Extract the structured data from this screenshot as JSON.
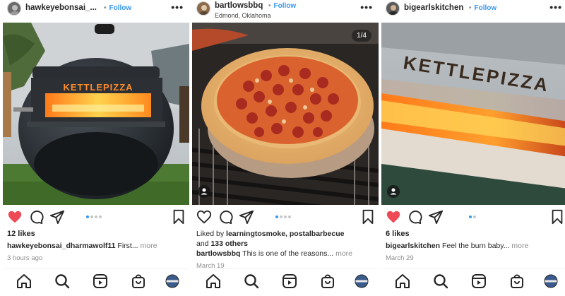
{
  "posts": [
    {
      "username": "hawkeyebonsai_...",
      "follow_label": "Follow",
      "location": "",
      "more_label": "•••",
      "liked": true,
      "carousel_dots": 4,
      "carousel_active": 1,
      "likes_text": "12 likes",
      "liked_by_prefix": "",
      "liked_by_names": "",
      "liked_by_suffix": "",
      "caption_user": "hawkeyebonsai_dharmawolf11",
      "caption_text": "First...",
      "caption_more": "more",
      "timestamp": "3 hours ago",
      "photo_text": "KETTLEPIZZA"
    },
    {
      "username": "bartlowsbbq",
      "follow_label": "Follow",
      "location": "Edmond, Oklahoma",
      "more_label": "•••",
      "liked": false,
      "photo_counter": "1/4",
      "carousel_dots": 4,
      "carousel_active": 1,
      "likes_text": "",
      "liked_by_prefix": "Liked by ",
      "liked_by_names": "learningtosmoke, postalbarbecue",
      "liked_by_suffix_prefix": "and ",
      "liked_by_suffix": "133 others",
      "caption_user": "bartlowsbbq",
      "caption_text": "This is one of the reasons...",
      "caption_more": "more",
      "timestamp": "March 19"
    },
    {
      "username": "bigearlskitchen",
      "follow_label": "Follow",
      "location": "",
      "more_label": "•••",
      "liked": true,
      "carousel_dots": 2,
      "carousel_active": 1,
      "likes_text": "6 likes",
      "liked_by_prefix": "",
      "liked_by_names": "",
      "liked_by_suffix": "",
      "caption_user": "bigearlskitchen",
      "caption_text": "Feel the burn baby...",
      "caption_more": "more",
      "timestamp": "March 29",
      "photo_text": "KETTLEPIZZA"
    }
  ],
  "nav_icons": [
    "home-icon",
    "search-icon",
    "reels-icon",
    "shop-icon",
    "profile-avatar"
  ],
  "colors": {
    "link_blue": "#3897f0",
    "like_red": "#ed4956",
    "muted_gray": "#8e8e8e"
  }
}
